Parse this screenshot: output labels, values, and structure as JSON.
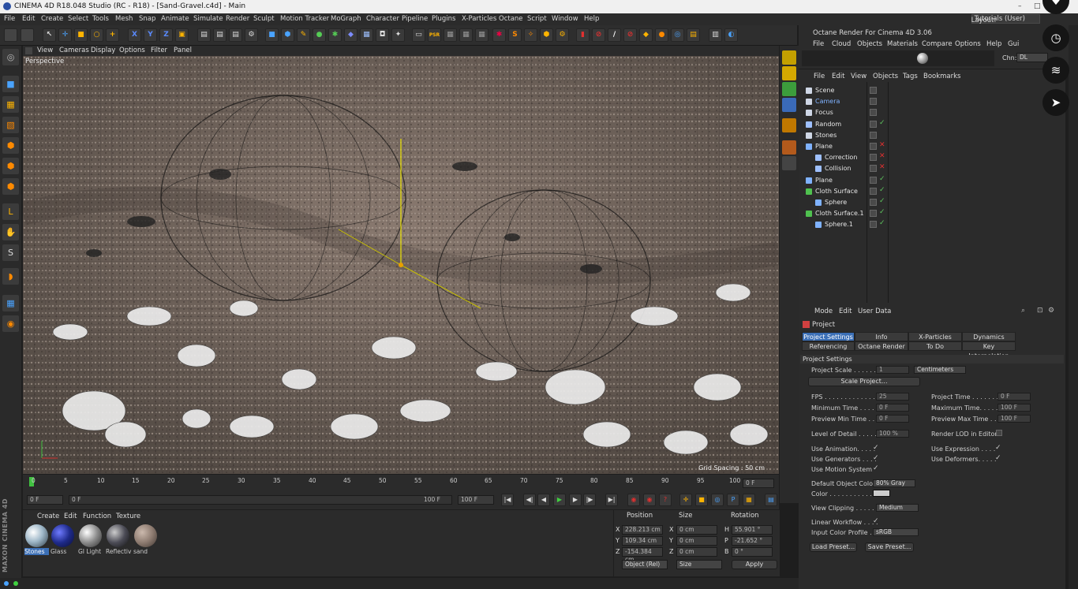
{
  "window": {
    "title": "CINEMA 4D R18.048 Studio (RC - R18) - [Sand-Gravel.c4d] - Main",
    "layout_label": "Layout:",
    "layout_value": "Tutorials (User)"
  },
  "menubar": [
    "File",
    "Edit",
    "Create",
    "Select",
    "Tools",
    "Mesh",
    "Snap",
    "Animate",
    "Simulate",
    "Render",
    "Sculpt",
    "Motion Tracker",
    "MoGraph",
    "Character",
    "Pipeline",
    "Plugins",
    "X-Particles",
    "Octane",
    "Script",
    "Window",
    "Help"
  ],
  "viewport": {
    "menu": [
      "View",
      "Cameras",
      "Display",
      "Options",
      "Filter",
      "Panel"
    ],
    "label": "Perspective",
    "grid_spacing": "Grid Spacing : 50 cm"
  },
  "timeline": {
    "ticks": [
      "0",
      "5",
      "10",
      "15",
      "20",
      "25",
      "30",
      "35",
      "40",
      "45",
      "50",
      "55",
      "60",
      "65",
      "70",
      "75",
      "80",
      "85",
      "90",
      "95",
      "100"
    ],
    "current_frame": "0 F",
    "start": "0 F",
    "range_start": "0 F",
    "range_end": "100 F",
    "end": "100 F"
  },
  "materials": {
    "menu": [
      "Create",
      "Edit",
      "Function",
      "Texture"
    ],
    "items": [
      {
        "name": "Stones",
        "color": "#9fb8c9"
      },
      {
        "name": "Glass",
        "color": "#1e2a8a"
      },
      {
        "name": "GI Light",
        "color": "#8a8a8a"
      },
      {
        "name": "Reflectiv",
        "color": "#4b4b55"
      },
      {
        "name": "sand",
        "color": "#8d7b70"
      }
    ]
  },
  "coordinates": {
    "headers": [
      "Position",
      "Size",
      "Rotation"
    ],
    "pos": {
      "x": "228.213 cm",
      "y": "109.34 cm",
      "z": "-154.384 cm"
    },
    "size": {
      "x": "0 cm",
      "y": "0 cm",
      "z": "0 cm"
    },
    "rot": {
      "h": "55.901 °",
      "p": "-21.652 °",
      "b": "0 °"
    },
    "mode": "Object (Rel)",
    "size_mode": "Size",
    "apply": "Apply"
  },
  "brand": "MAXON CINEMA 4D",
  "octane": {
    "title": "Octane Render For Cinema 4D 3.06",
    "menu": [
      "File",
      "Cloud",
      "Objects",
      "Materials",
      "Compare",
      "Options",
      "Help",
      "Gui"
    ],
    "chn_label": "Chn:",
    "chn_value": "DL"
  },
  "object_manager": {
    "menu": [
      "File",
      "Edit",
      "View",
      "Objects",
      "Tags",
      "Bookmarks"
    ],
    "rows": [
      {
        "name": "Scene",
        "indent": 0,
        "status": "none",
        "icon": "#cfd7e6"
      },
      {
        "name": "Camera",
        "indent": 0,
        "status": "none",
        "icon": "#cfd7e6",
        "highlight": true
      },
      {
        "name": "Focus",
        "indent": 0,
        "status": "none",
        "icon": "#cfd7e6"
      },
      {
        "name": "Random",
        "indent": 0,
        "status": "check",
        "icon": "#9ec0ff"
      },
      {
        "name": "Stones",
        "indent": 0,
        "status": "none",
        "icon": "#cfd7e6"
      },
      {
        "name": "Plane",
        "indent": 0,
        "status": "cross",
        "icon": "#7fb2ff"
      },
      {
        "name": "Correction",
        "indent": 1,
        "status": "cross",
        "icon": "#9ec0ff"
      },
      {
        "name": "Collision",
        "indent": 1,
        "status": "cross",
        "icon": "#9ec0ff"
      },
      {
        "name": "Plane",
        "indent": 0,
        "status": "check",
        "icon": "#7fb2ff"
      },
      {
        "name": "Cloth Surface",
        "indent": 0,
        "status": "check",
        "icon": "#4fc14f"
      },
      {
        "name": "Sphere",
        "indent": 1,
        "status": "check",
        "icon": "#7fb2ff"
      },
      {
        "name": "Cloth Surface.1",
        "indent": 0,
        "status": "check",
        "icon": "#4fc14f"
      },
      {
        "name": "Sphere.1",
        "indent": 1,
        "status": "check",
        "icon": "#7fb2ff"
      }
    ]
  },
  "attributes": {
    "menu": [
      "Mode",
      "Edit",
      "User Data"
    ],
    "title": "Project",
    "tabs": [
      {
        "label": "Project Settings",
        "active": true
      },
      {
        "label": "Info",
        "active": false
      },
      {
        "label": "X-Particles",
        "active": false
      },
      {
        "label": "Dynamics",
        "active": false
      },
      {
        "label": "Referencing",
        "active": false
      },
      {
        "label": "Octane Render",
        "active": false
      },
      {
        "label": "To Do",
        "active": false
      },
      {
        "label": "Key Interpolation",
        "active": false
      }
    ],
    "section": "Project Settings",
    "project_scale_label": "Project Scale . . . . . .",
    "project_scale_value": "1",
    "project_scale_unit": "Centimeters",
    "scale_project": "Scale Project...",
    "fps_label": "FPS . . . . . . . . . . . . . .",
    "fps": "25",
    "project_time_label": "Project Time . . . . . . .",
    "project_time": "0 F",
    "min_time_label": "Minimum Time . . . . . .",
    "min_time": "0 F",
    "max_time_label": "Maximum Time. . . . . .",
    "max_time": "100 F",
    "prev_min_label": "Preview Min Time . . .",
    "prev_min": "0 F",
    "prev_max_label": "Preview Max Time . . .",
    "prev_max": "100 F",
    "lod_label": "Level of Detail . . . . .",
    "lod": "100 %",
    "render_lod_label": "Render LOD in Editor",
    "use_animation": "Use Animation. . . . .",
    "use_expression": "Use Expression . . . .",
    "use_generators": "Use Generators . . . .",
    "use_deformers": "Use Deformers. . . . .",
    "use_motion": "Use Motion System",
    "default_color_label": "Default Object Color",
    "default_color": "80% Gray",
    "color_label": "Color . . . . . . . . . . . .",
    "view_clipping_label": "View Clipping . . . . . .",
    "view_clipping": "Medium",
    "linear_workflow_label": "Linear Workflow . . . .",
    "input_profile_label": "Input Color Profile . .",
    "input_profile": "sRGB",
    "load_preset": "Load Preset...",
    "save_preset": "Save Preset..."
  }
}
